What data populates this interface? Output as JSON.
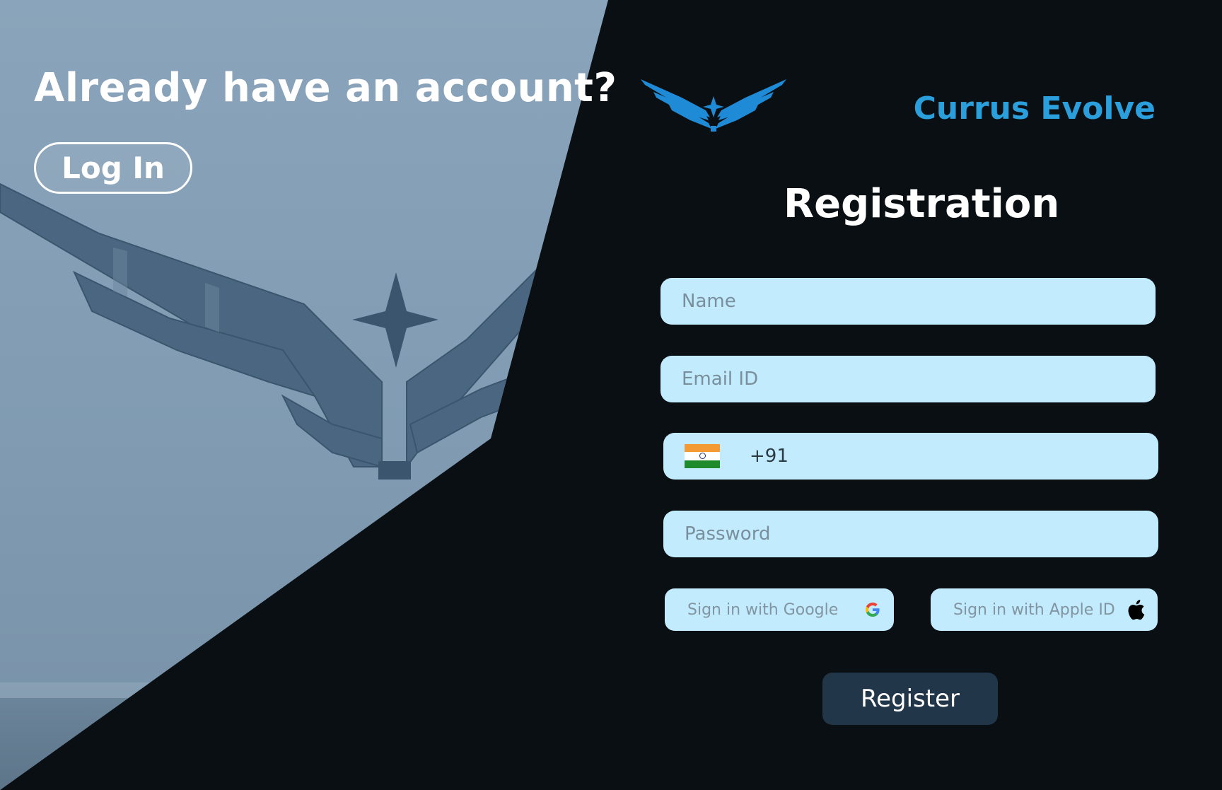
{
  "left": {
    "headline": "Already have an account?",
    "login_label": "Log In"
  },
  "brand": {
    "name": "Currus Evolve",
    "accent": "#2b9fdc"
  },
  "form": {
    "title": "Registration",
    "name_placeholder": "Name",
    "email_placeholder": "Email ID",
    "phone_code": "+91",
    "phone_country_icon": "india-flag-icon",
    "password_placeholder": "Password",
    "google_label": "Sign in with Google",
    "apple_label": "Sign in with Apple ID",
    "register_label": "Register",
    "field_bg": "#c2ebfd",
    "button_bg": "#223649"
  }
}
